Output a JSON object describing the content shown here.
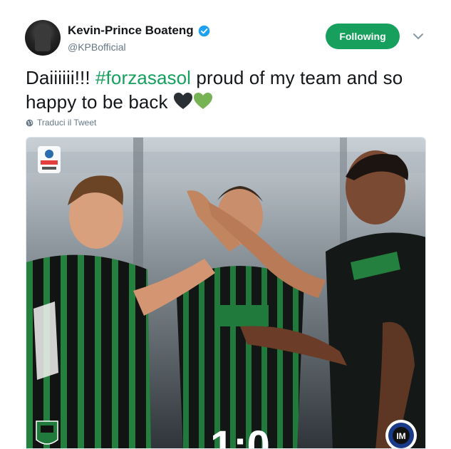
{
  "user": {
    "name": "Kevin-Prince Boateng",
    "handle": "@KPBofficial",
    "verified": true
  },
  "follow_button": {
    "label": "Following",
    "color": "#17a05d"
  },
  "tweet": {
    "text_before": "Daiiiiii!!! ",
    "hashtag": "#forzasasol",
    "text_after": " proud of my team and so happy to be back ",
    "emoji": [
      "black-heart",
      "green-heart"
    ]
  },
  "translate": {
    "label": "Traduci il Tweet"
  },
  "media": {
    "description_icons": [
      "serie-a-logo",
      "sassuolo-badge",
      "inter-badge"
    ],
    "score": "1:0",
    "badges": {
      "serie_a": "SERIE A",
      "serie_a_sponsor": "TIM",
      "sassuolo": "U.S.S."
    }
  },
  "colors": {
    "accent": "#17a05d",
    "verified": "#1da1f2",
    "muted": "#657786"
  }
}
